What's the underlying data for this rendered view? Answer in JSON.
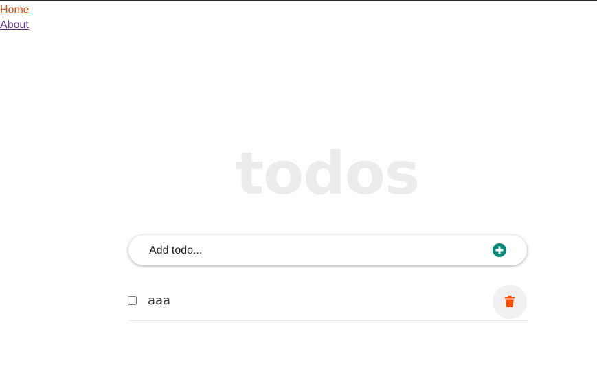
{
  "nav": {
    "home_label": "Home",
    "about_label": "About"
  },
  "header": {
    "title": "todos"
  },
  "add_todo": {
    "placeholder": "Add todo...",
    "icon": "plus-circle-icon",
    "icon_color": "#00897b"
  },
  "todos": [
    {
      "text": "aaa",
      "completed": false,
      "delete_icon": "trash-icon",
      "delete_icon_color": "#ff4d00"
    }
  ],
  "colors": {
    "home_link": "#d9480f",
    "about_link": "#5b2a86",
    "title": "#ebebeb"
  }
}
